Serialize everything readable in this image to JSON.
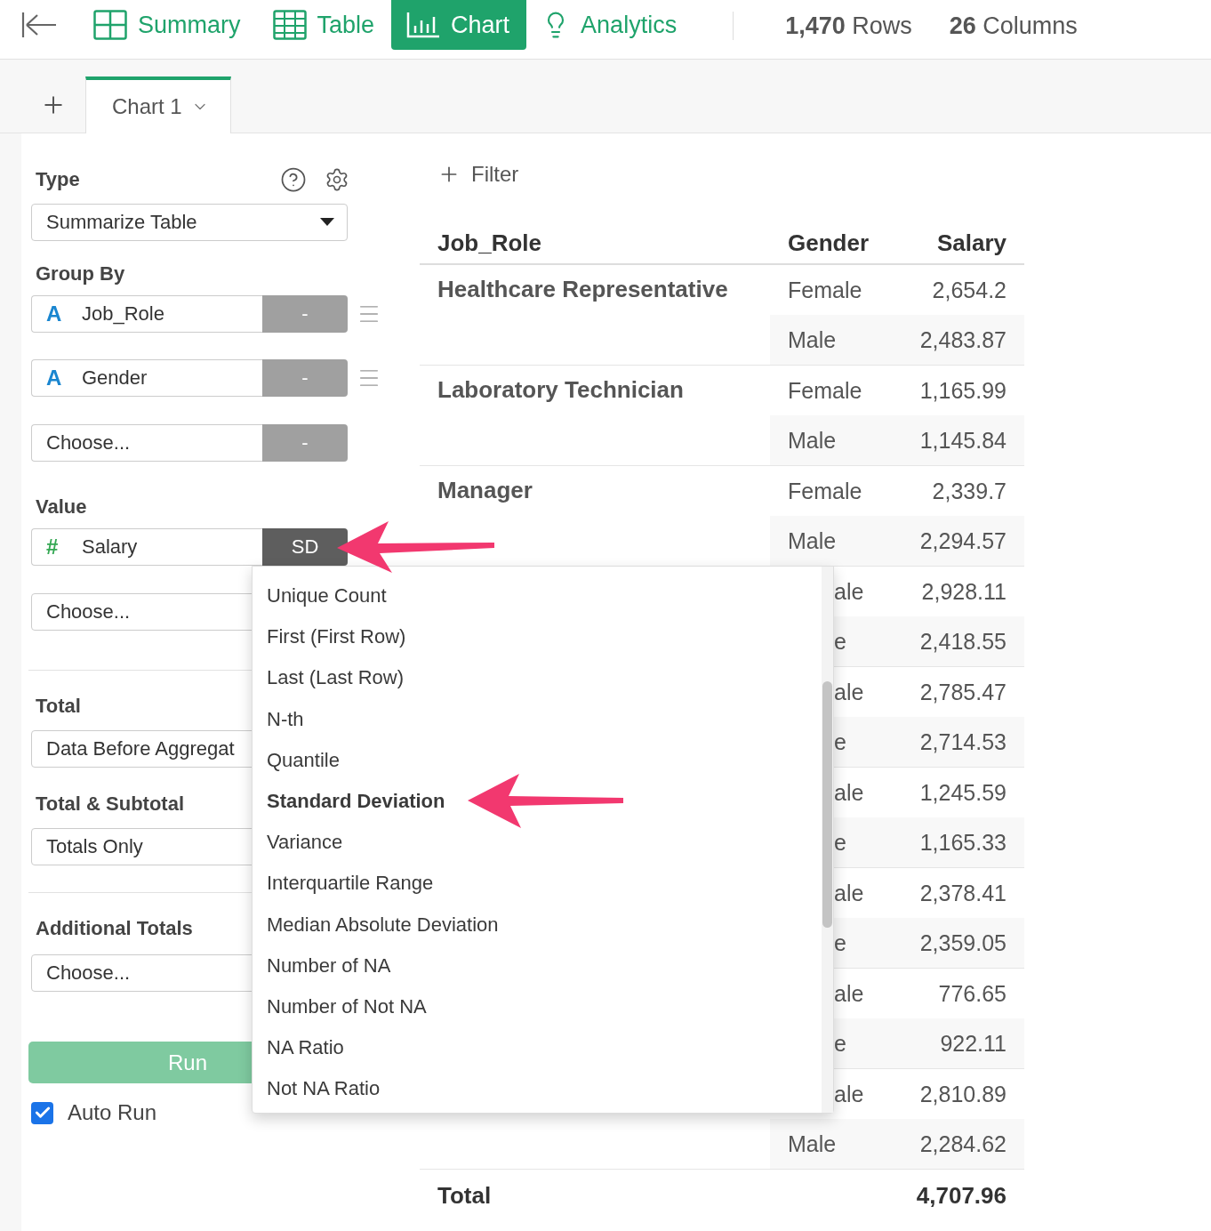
{
  "nav": {
    "tabs": [
      {
        "kind": "summary",
        "label": "Summary",
        "selected": false
      },
      {
        "kind": "table",
        "label": "Table",
        "selected": false
      },
      {
        "kind": "chart",
        "label": "Chart",
        "selected": true
      },
      {
        "kind": "analytics",
        "label": "Analytics",
        "selected": false
      }
    ],
    "stats": [
      {
        "number": "1,470",
        "label": "Rows"
      },
      {
        "number": "26",
        "label": "Columns"
      }
    ]
  },
  "chart_tabs": [
    {
      "label": "Chart 1",
      "selected": true
    }
  ],
  "settings": {
    "type": {
      "label": "Type",
      "value": "Summarize Table"
    },
    "group_by": {
      "label": "Group By",
      "fields": [
        {
          "type_icon": "A",
          "value": "Job_Role",
          "action": "-",
          "open": false,
          "draggable": true
        },
        {
          "type_icon": "A",
          "value": "Gender",
          "action": "-",
          "open": false,
          "draggable": true
        },
        {
          "placeholder": "Choose...",
          "action": "-",
          "open": false,
          "draggable": false
        }
      ]
    },
    "value": {
      "label": "Value",
      "fields": [
        {
          "type_icon": "#",
          "value": "Salary",
          "action": "SD",
          "open": true
        },
        {
          "placeholder": "Choose..."
        }
      ]
    },
    "total": {
      "label": "Total",
      "value": "Data Before Aggregat"
    },
    "total_subtotal": {
      "label": "Total & Subtotal",
      "value": "Totals Only"
    },
    "additional_totals": {
      "label": "Additional Totals",
      "placeholder": "Choose..."
    },
    "run_button": {
      "label": "Run",
      "disabled": true
    },
    "auto_run": {
      "label": "Auto Run",
      "checked": true
    }
  },
  "filter": {
    "label": "Filter"
  },
  "table": {
    "columns": [
      "Job_Role",
      "Gender",
      "Salary"
    ],
    "groups": [
      {
        "role": "Healthcare Representative",
        "rows": [
          {
            "gender": "Female",
            "salary": "2,654.2"
          },
          {
            "gender": "Male",
            "salary": "2,483.87"
          }
        ]
      },
      {
        "role": "Laboratory Technician",
        "rows": [
          {
            "gender": "Female",
            "salary": "1,165.99"
          },
          {
            "gender": "Male",
            "salary": "1,145.84"
          }
        ]
      },
      {
        "role": "Manager",
        "rows": [
          {
            "gender": "Female",
            "salary": "2,339.7"
          },
          {
            "gender": "Male",
            "salary": "2,294.57"
          }
        ]
      },
      {
        "rows": [
          {
            "gender": "ale",
            "salary": "2,928.11"
          },
          {
            "gender": "e",
            "salary": "2,418.55"
          }
        ]
      },
      {
        "rows": [
          {
            "gender": "ale",
            "salary": "2,785.47"
          },
          {
            "gender": "e",
            "salary": "2,714.53"
          }
        ]
      },
      {
        "rows": [
          {
            "gender": "ale",
            "salary": "1,245.59"
          },
          {
            "gender": "e",
            "salary": "1,165.33"
          }
        ]
      },
      {
        "rows": [
          {
            "gender": "ale",
            "salary": "2,378.41"
          },
          {
            "gender": "e",
            "salary": "2,359.05"
          }
        ]
      },
      {
        "rows": [
          {
            "gender": "ale",
            "salary": "776.65"
          },
          {
            "gender": "e",
            "salary": "922.11"
          }
        ]
      },
      {
        "rows": [
          {
            "gender": "ale",
            "salary": "2,810.89"
          },
          {
            "gender": "Male",
            "salary": "2,284.62"
          }
        ]
      }
    ],
    "total": {
      "label": "Total",
      "value": "4,707.96"
    }
  },
  "menu": {
    "items": [
      {
        "label": "Unique Count",
        "selected": false
      },
      {
        "label": "First (First Row)",
        "selected": false
      },
      {
        "label": "Last (Last Row)",
        "selected": false
      },
      {
        "label": "N-th",
        "selected": false
      },
      {
        "label": "Quantile",
        "selected": false
      },
      {
        "label": "Standard Deviation",
        "selected": true
      },
      {
        "label": "Variance",
        "selected": false
      },
      {
        "label": "Interquartile Range",
        "selected": false
      },
      {
        "label": "Median Absolute Deviation",
        "selected": false
      },
      {
        "label": "Number of NA",
        "selected": false
      },
      {
        "label": "Number of Not NA",
        "selected": false
      },
      {
        "label": "NA Ratio",
        "selected": false
      },
      {
        "label": "Not NA Ratio",
        "selected": false
      }
    ]
  }
}
